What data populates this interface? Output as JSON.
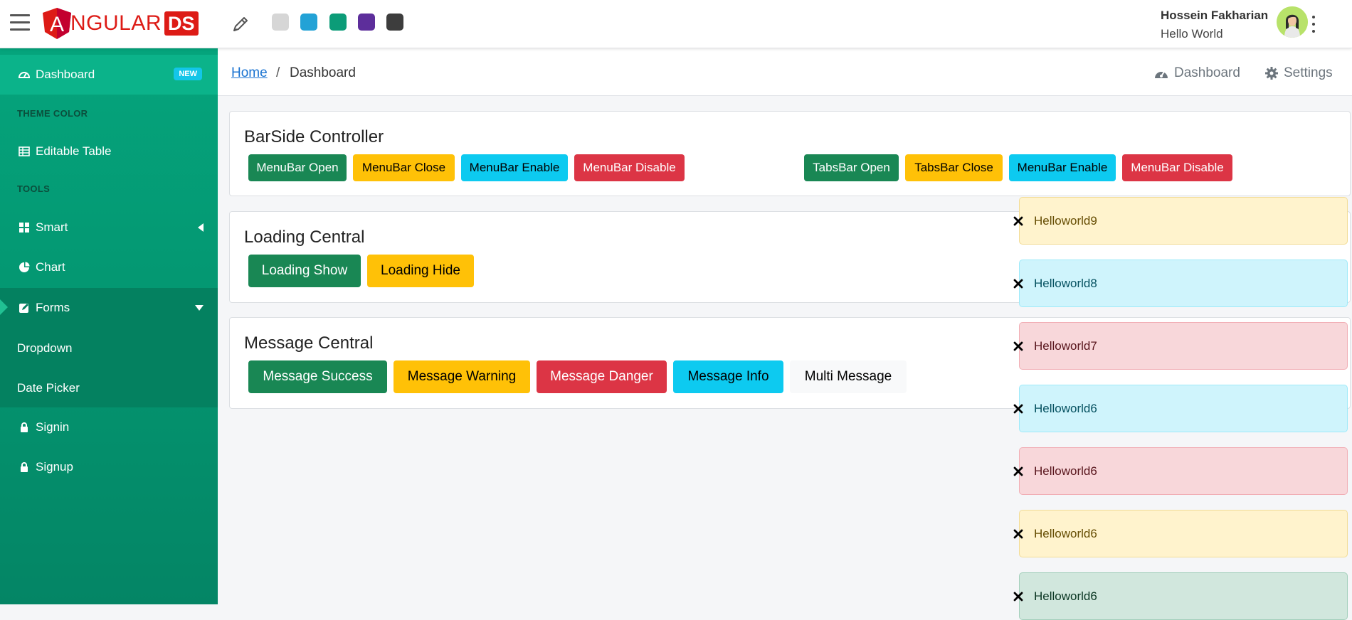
{
  "header": {
    "logo_text": "NGULAR",
    "logo_letter": "A",
    "logo_badge": "DS",
    "theme_swatches": [
      {
        "name": "light-gray",
        "color": "#d6d6d6"
      },
      {
        "name": "blue",
        "color": "#23a2d6"
      },
      {
        "name": "green",
        "color": "#0c9c78"
      },
      {
        "name": "purple",
        "color": "#5d2e9b"
      },
      {
        "name": "dark",
        "color": "#3d3d3d"
      }
    ],
    "user_name": "Hossein Fakharian",
    "user_subtitle": "Hello World"
  },
  "sidebar": {
    "dashboard": {
      "label": "Dashboard",
      "badge": "NEW"
    },
    "section_theme": "THEME COLOR",
    "editable_table": "Editable Table",
    "section_tools": "TOOLS",
    "smart": "Smart",
    "chart": "Chart",
    "forms": "Forms",
    "forms_children": [
      "Dropdown",
      "Date Picker"
    ],
    "signin": "Signin",
    "signup": "Signup",
    "colors": {
      "bg": "#05a47c",
      "active": "#0bb38a"
    }
  },
  "breadcrumb": {
    "home": "Home",
    "separator": "/",
    "current": "Dashboard",
    "right_links": {
      "dashboard": "Dashboard",
      "settings": "Settings"
    }
  },
  "barside": {
    "title": "BarSide Controller",
    "buttons": [
      "MenuBar Open",
      "MenuBar Close",
      "MenuBar Enable",
      "MenuBar Disable",
      "TabsBar Open",
      "TabsBar Close",
      "MenuBar Enable",
      "MenuBar Disable"
    ]
  },
  "loading": {
    "title": "Loading Central",
    "buttons": [
      "Loading Show",
      "Loading Hide"
    ]
  },
  "message": {
    "title": "Message Central",
    "buttons": [
      "Message Success",
      "Message Warning",
      "Message Danger",
      "Message Info",
      "Multi Message"
    ]
  },
  "toasts": [
    {
      "text": "Helloworld9",
      "type": "warning"
    },
    {
      "text": "Helloworld8",
      "type": "info"
    },
    {
      "text": "Helloworld7",
      "type": "danger"
    },
    {
      "text": "Helloworld6",
      "type": "info"
    },
    {
      "text": "Helloworld6",
      "type": "danger"
    },
    {
      "text": "Helloworld6",
      "type": "warning"
    },
    {
      "text": "Helloworld6",
      "type": "success"
    }
  ]
}
